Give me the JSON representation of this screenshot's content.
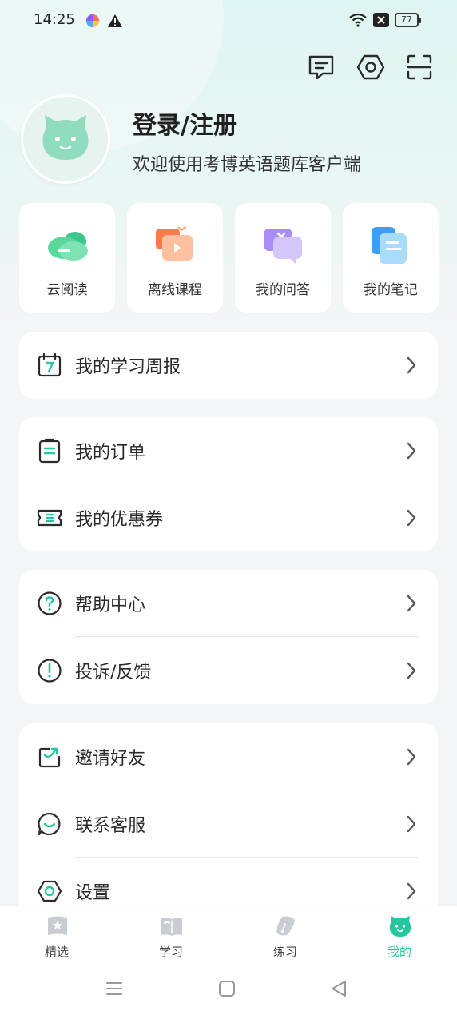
{
  "status_bar": {
    "time": "14:25",
    "battery": "77",
    "icons": [
      "app-icon",
      "warning-icon",
      "wifi-icon",
      "x-icon",
      "battery-icon"
    ]
  },
  "header_icons": [
    "message-icon",
    "settings-hex-icon",
    "scan-icon"
  ],
  "profile": {
    "title": "登录/注册",
    "subtitle": "欢迎使用考博英语题库客户端"
  },
  "quick_actions": [
    {
      "label": "云阅读",
      "icon": "cloud-icon"
    },
    {
      "label": "离线课程",
      "icon": "video-icon"
    },
    {
      "label": "我的问答",
      "icon": "chat-bubbles-icon"
    },
    {
      "label": "我的笔记",
      "icon": "notes-icon"
    }
  ],
  "menu": {
    "weekly": {
      "label": "我的学习周报",
      "icon": "calendar-icon"
    },
    "orders": {
      "label": "我的订单",
      "icon": "clipboard-icon"
    },
    "coupons": {
      "label": "我的优惠券",
      "icon": "ticket-icon"
    },
    "help": {
      "label": "帮助中心",
      "icon": "question-icon"
    },
    "feedback": {
      "label": "投诉/反馈",
      "icon": "exclamation-icon"
    },
    "invite": {
      "label": "邀请好友",
      "icon": "invite-icon"
    },
    "service": {
      "label": "联系客服",
      "icon": "smile-bubble-icon"
    },
    "settings": {
      "label": "设置",
      "icon": "hex-settings-icon"
    }
  },
  "bottom_nav": [
    {
      "label": "精选",
      "icon": "star-book-icon"
    },
    {
      "label": "学习",
      "icon": "book-icon"
    },
    {
      "label": "练习",
      "icon": "pen-icon"
    },
    {
      "label": "我的",
      "icon": "cat-icon",
      "active": true
    }
  ],
  "colors": {
    "accent": "#25c79f",
    "header_bg": "#dff5f1",
    "page_bg": "#f4f5f6"
  }
}
